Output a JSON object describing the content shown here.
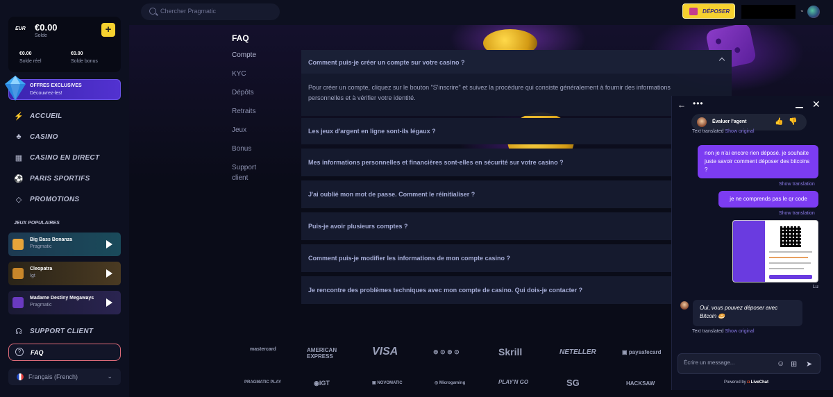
{
  "wallet": {
    "currency": "EUR",
    "balance": "€0.00",
    "balance_label": "Solde",
    "real": "€0.00",
    "real_label": "Solde réel",
    "bonus": "€0.00",
    "bonus_label": "Solde bonus",
    "add": "+"
  },
  "promo": {
    "title": "OFFRES EXCLUSIVES",
    "subtitle": "Découvrez-les!"
  },
  "nav": [
    {
      "label": "ACCUEIL",
      "icon": "lightning-icon"
    },
    {
      "label": "CASINO",
      "icon": "clubs-icon"
    },
    {
      "label": "CASINO EN DIRECT",
      "icon": "cards-icon"
    },
    {
      "label": "PARIS SPORTIFS",
      "icon": "football-icon"
    },
    {
      "label": "PROMOTIONS",
      "icon": "diamond-icon"
    }
  ],
  "popular_label": "JEUX POPULAIRES",
  "games": [
    {
      "title": "Big Bass Bonanza",
      "provider": "Pragmatic",
      "color": "#2a5a8a"
    },
    {
      "title": "Cleopatra",
      "provider": "Igt",
      "color": "#8a6a2a"
    },
    {
      "title": "Madame Destiny Megaways",
      "provider": "Pragmatic",
      "color": "#3a2a6a"
    }
  ],
  "support_label": "SUPPORT CLIENT",
  "faq_label": "FAQ",
  "language": "Français (French)",
  "search": {
    "placeholder": "Chercher Pragmatic"
  },
  "deposit_label": "DÉPOSER",
  "faq_nav": {
    "title": "FAQ",
    "links": [
      "Compte",
      "KYC",
      "Dépôts",
      "Retraits",
      "Jeux",
      "Bonus",
      "Support client"
    ]
  },
  "faq_items": [
    {
      "q": "Comment puis-je créer un compte sur votre casino ?",
      "a": "Pour créer un compte, cliquez sur le bouton \"S'inscrire\" et suivez la procédure qui consiste généralement à fournir des informations personnelles et à vérifier votre identité."
    },
    {
      "q": "Les jeux d'argent en ligne sont-ils légaux ?"
    },
    {
      "q": "Mes informations personnelles et financières sont-elles en sécurité sur votre casino ?"
    },
    {
      "q": "J'ai oublié mon mot de passe. Comment le réinitialiser ?"
    },
    {
      "q": "Puis-je avoir plusieurs comptes ?"
    },
    {
      "q": "Comment puis-je modifier les informations de mon compte casino ?"
    },
    {
      "q": "Je rencontre des problèmes techniques avec mon compte de casino. Qui dois-je contacter ?"
    }
  ],
  "payments_row1": [
    "mastercard",
    "AMERICAN EXPRESS",
    "VISA",
    "⊚ ⊙ ⊚ ⊙",
    "Skrill",
    "NETELLER",
    "▣ paysafecard"
  ],
  "payments_row2": [
    "PRAGMATIC PLAY",
    "◉IGT",
    "▣ NOVOMATIC",
    "◎ Microgaming",
    "PLAY'N GO",
    "SG",
    "HACKSAW"
  ],
  "chat": {
    "rate_label": "Évaluer l'agent",
    "text_translated": "Text translated",
    "show_original": "Show original",
    "msg1": "non je n'ai encore rien déposé. je souhaite juste savoir comment déposer des bitcoins ?",
    "show_translation": "Show translation",
    "msg2": "je ne comprends pas le qr code",
    "read": "Lu",
    "agent_msg": "Oui, vous pouvez déposer avec Bitcoin 🥯",
    "input_placeholder": "Écrire un message...",
    "powered_by": "Powered by",
    "brand": "LiveChat"
  }
}
